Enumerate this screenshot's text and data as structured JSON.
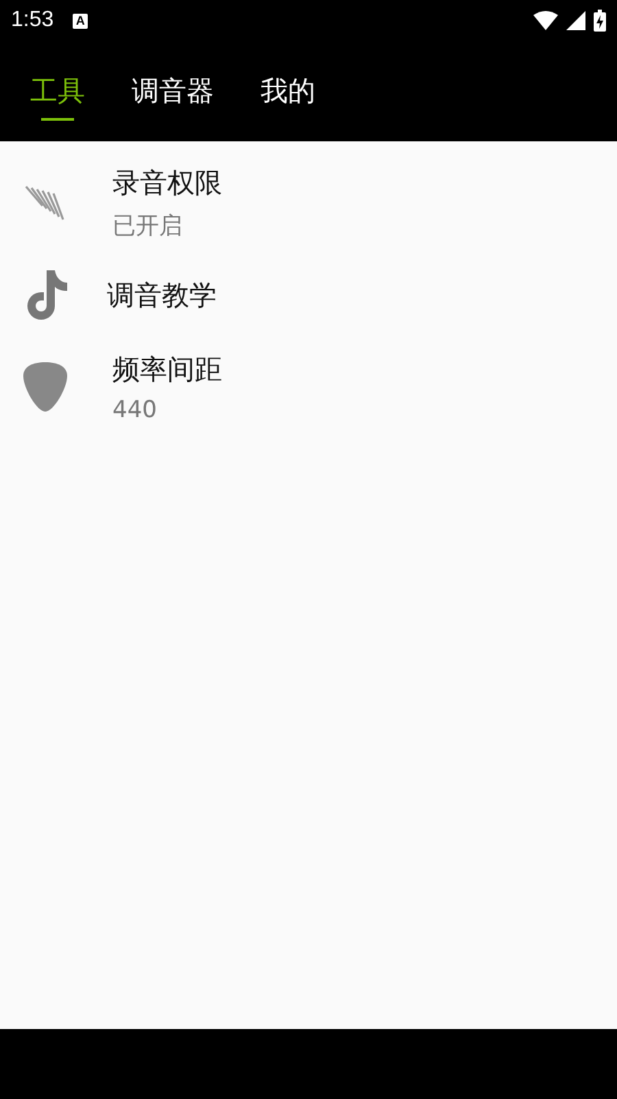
{
  "status_bar": {
    "time": "1:53",
    "notification": "A"
  },
  "tabs": [
    {
      "label": "工具",
      "selected": true
    },
    {
      "label": "调音器",
      "selected": false
    },
    {
      "label": "我的",
      "selected": false
    }
  ],
  "items": [
    {
      "title": "录音权限",
      "subtitle": "已开启"
    },
    {
      "title": "调音教学"
    },
    {
      "title": "频率间距",
      "subtitle": "440"
    }
  ]
}
